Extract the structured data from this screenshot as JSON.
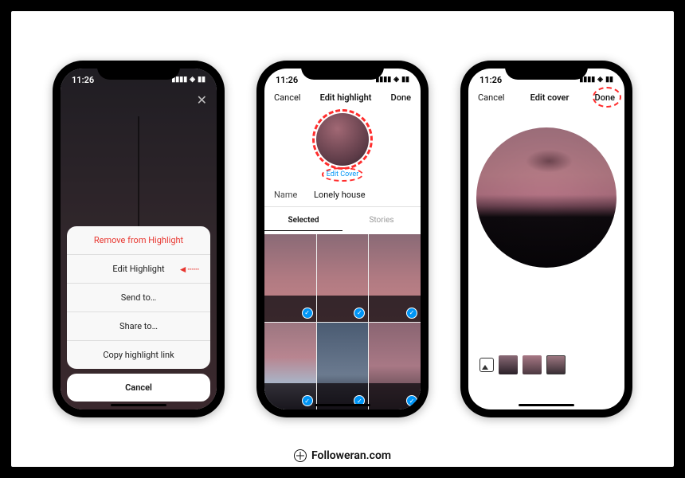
{
  "status": {
    "time": "11:26",
    "signal": "••••",
    "wifi": "✓",
    "battery": "■"
  },
  "phone1": {
    "sheet": {
      "remove": "Remove from Highlight",
      "edit": "Edit Highlight",
      "send": "Send to…",
      "share": "Share to…",
      "copy": "Copy highlight link",
      "cancel": "Cancel"
    }
  },
  "phone2": {
    "header": {
      "cancel": "Cancel",
      "title": "Edit highlight",
      "done": "Done"
    },
    "edit_cover": "Edit Cover",
    "name_label": "Name",
    "name_value": "Lonely house",
    "tabs": {
      "selected": "Selected",
      "stories": "Stories"
    }
  },
  "phone3": {
    "header": {
      "cancel": "Cancel",
      "title": "Edit cover",
      "done": "Done"
    }
  },
  "watermark": "Followeran.com",
  "colors": {
    "accent_red": "#ff2d2d",
    "blue": "#0095f6"
  }
}
